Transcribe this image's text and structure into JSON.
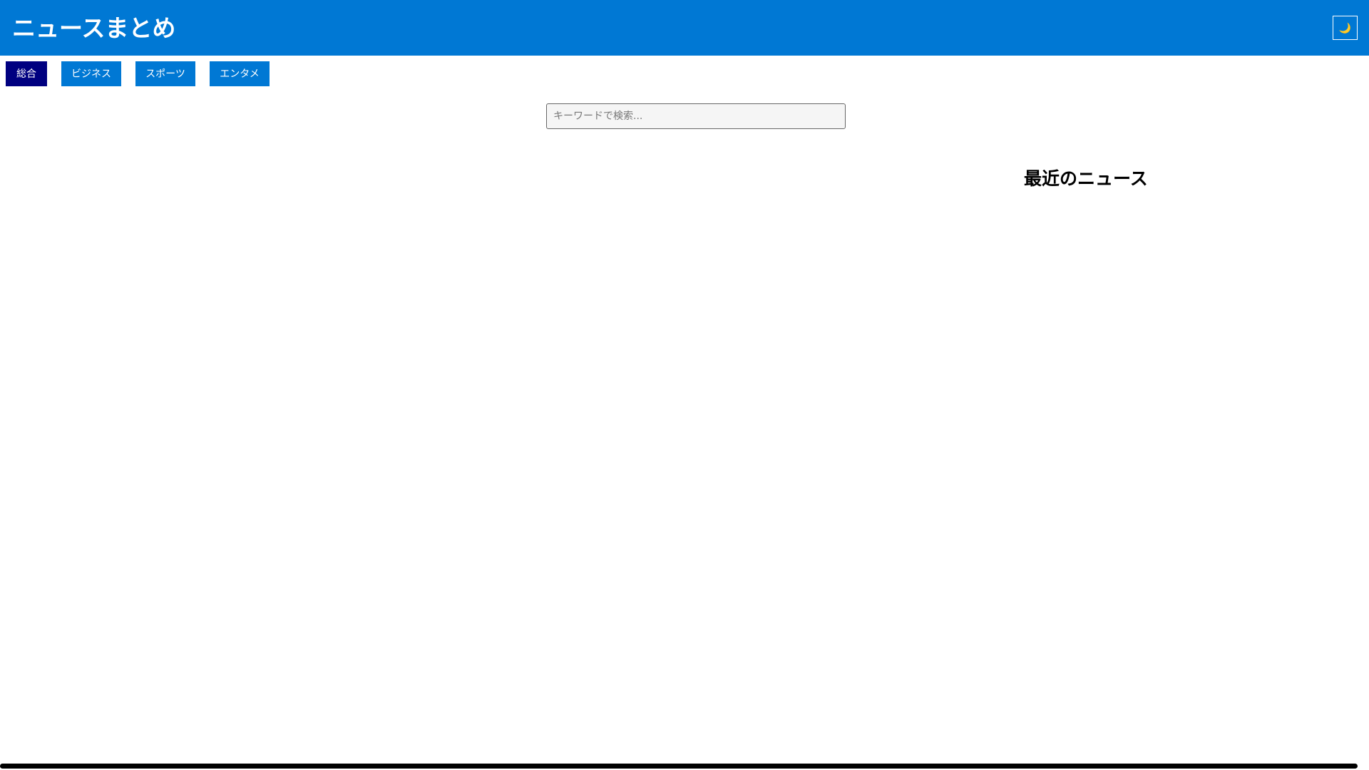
{
  "header": {
    "title": "ニュースまとめ",
    "theme_toggle_icon": "🌙",
    "theme_toggle_icon_name": "moon-icon"
  },
  "tabs": [
    {
      "label": "総合",
      "active": true
    },
    {
      "label": "ビジネス",
      "active": false
    },
    {
      "label": "スポーツ",
      "active": false
    },
    {
      "label": "エンタメ",
      "active": false
    }
  ],
  "search": {
    "placeholder": "キーワードで検索...",
    "value": ""
  },
  "sidebar": {
    "recent_title": "最近のニュース"
  },
  "colors": {
    "header_bg": "#0078d4",
    "tab_bg": "#0078d4",
    "tab_active_bg": "#000080",
    "text_on_accent": "#ffffff"
  }
}
